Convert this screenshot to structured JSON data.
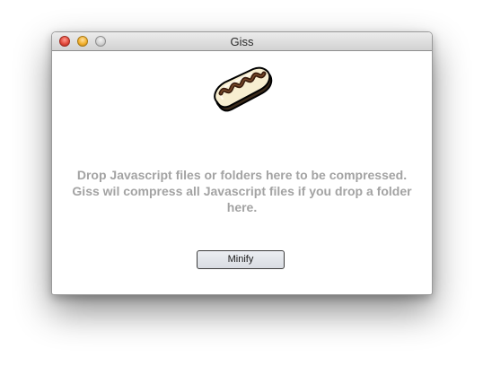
{
  "window": {
    "title": "Giss"
  },
  "traffic_lights": {
    "close_icon": "close-icon",
    "minimize_icon": "minimize-icon",
    "zoom_icon": "zoom-icon"
  },
  "app_icon": {
    "name": "eclair-pastry-icon"
  },
  "drop_message": {
    "line1": "Drop Javascript files or folders here to be compressed.",
    "line2": "Giss wil compress all Javascript files if you drop a folder",
    "line3": "here."
  },
  "minify_button": {
    "label": "Minify"
  },
  "colors": {
    "message_text": "#a3a3a3",
    "window_background": "#ffffff",
    "button_border": "#3c3c3c"
  }
}
